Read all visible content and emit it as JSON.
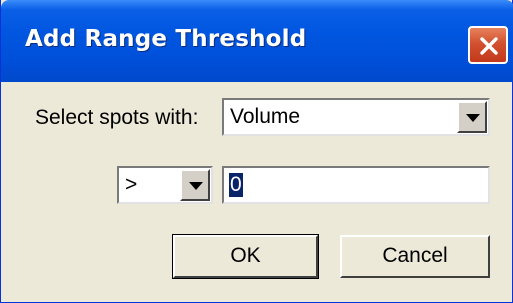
{
  "dialog": {
    "title": "Add Range Threshold",
    "close_icon": "close-x-icon",
    "select_label": "Select spots with:",
    "field_select": {
      "value": "Volume",
      "icon": "chevron-down-icon"
    },
    "operator_select": {
      "value": ">",
      "icon": "chevron-down-icon"
    },
    "threshold_input": {
      "value": "0"
    },
    "ok_label": "OK",
    "cancel_label": "Cancel"
  },
  "colors": {
    "title_bar": "#0050da",
    "dialog_bg": "#ece9d8",
    "close_button": "#c2391b",
    "selection": "#0a246a"
  }
}
